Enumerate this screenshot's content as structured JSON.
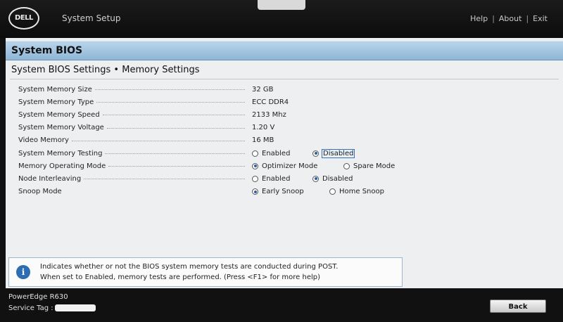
{
  "header": {
    "logo_text": "DELL",
    "app_title": "System Setup",
    "links": [
      "Help",
      "About",
      "Exit"
    ]
  },
  "section": {
    "title": "System BIOS"
  },
  "page": {
    "title": "System BIOS Settings • Memory Settings"
  },
  "settings": [
    {
      "label": "System Memory Size",
      "value": "32 GB"
    },
    {
      "label": "System Memory Type",
      "value": "ECC DDR4"
    },
    {
      "label": "System Memory Speed",
      "value": "2133 Mhz"
    },
    {
      "label": "System Memory Voltage",
      "value": "1.20 V"
    },
    {
      "label": "Video Memory",
      "value": "16 MB"
    },
    {
      "label": "System Memory Testing",
      "options": [
        "Enabled",
        "Disabled"
      ],
      "selected": "Disabled"
    },
    {
      "label": "Memory Operating Mode",
      "options": [
        "Optimizer Mode",
        "Spare Mode"
      ],
      "selected": "Optimizer Mode"
    },
    {
      "label": "Node Interleaving",
      "options": [
        "Enabled",
        "Disabled"
      ],
      "selected": "Disabled"
    },
    {
      "label": "Snoop Mode",
      "options": [
        "Early Snoop",
        "Home Snoop"
      ],
      "selected": "Early Snoop"
    }
  ],
  "help": {
    "line1": "Indicates whether or not the BIOS system memory tests are conducted during POST.",
    "line2": "When set to Enabled, memory tests are performed. (Press <F1> for more help)"
  },
  "footer": {
    "model": "PowerEdge R630",
    "service_tag_label": "Service Tag :",
    "back_label": "Back"
  },
  "colors": {
    "section_bar": "#a7c6e2",
    "radio_selected": "#2b5fa5",
    "info_icon": "#2d6db2"
  }
}
